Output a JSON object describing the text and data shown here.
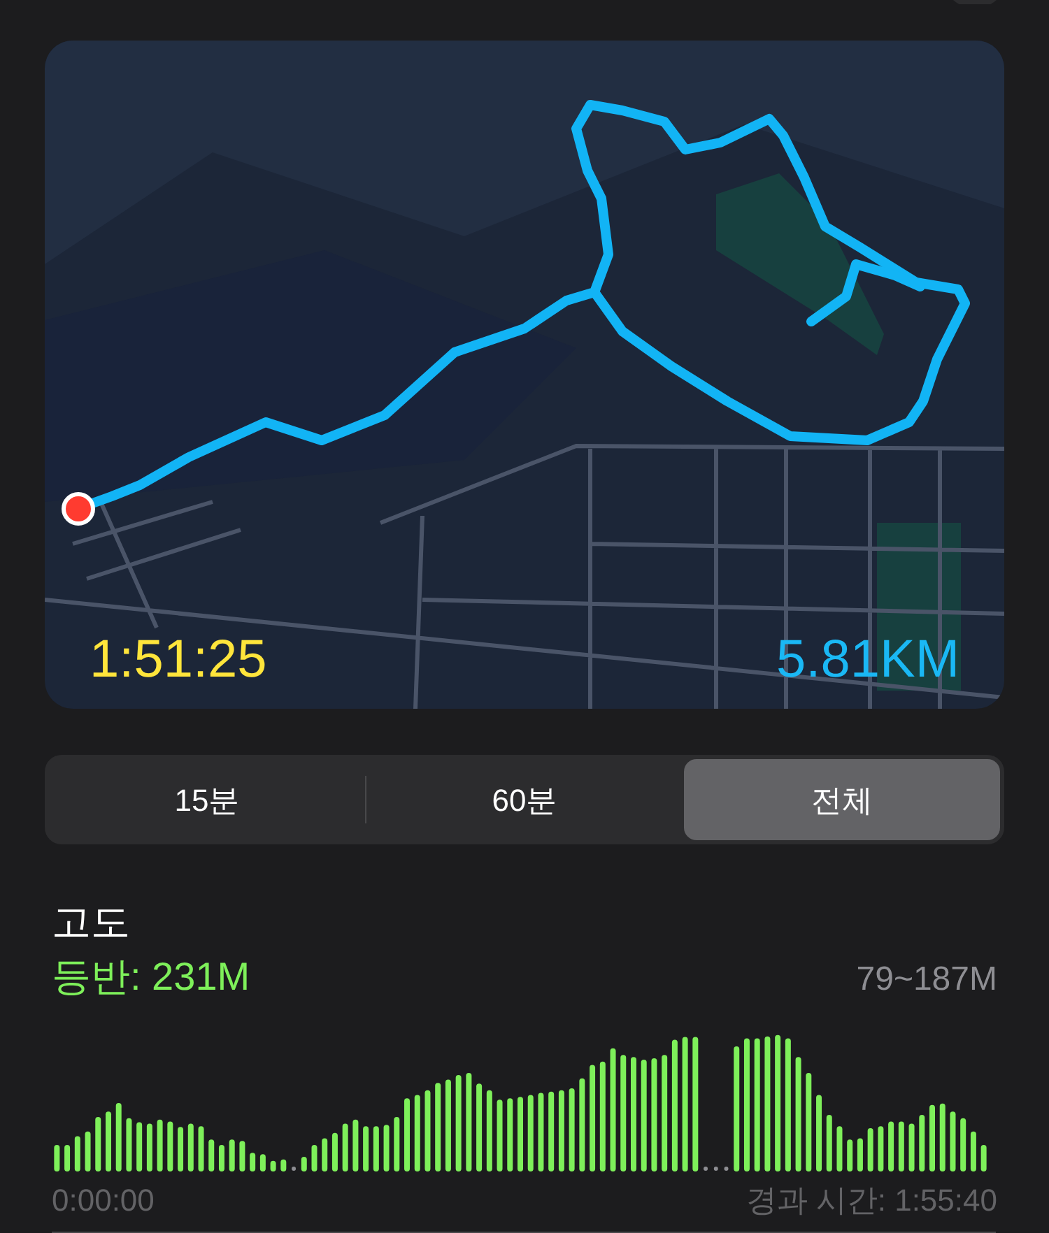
{
  "map": {
    "elapsed": "1:51:25",
    "distance": "5.81KM"
  },
  "range_tabs": [
    {
      "label": "15분",
      "selected": false
    },
    {
      "label": "60분",
      "selected": false
    },
    {
      "label": "전체",
      "selected": true
    }
  ],
  "elevation": {
    "title": "고도",
    "climb": "등반: 231M",
    "range": "79~187M",
    "axis_start": "0:00:00",
    "axis_end": "경과 시간: 1:55:40"
  }
}
